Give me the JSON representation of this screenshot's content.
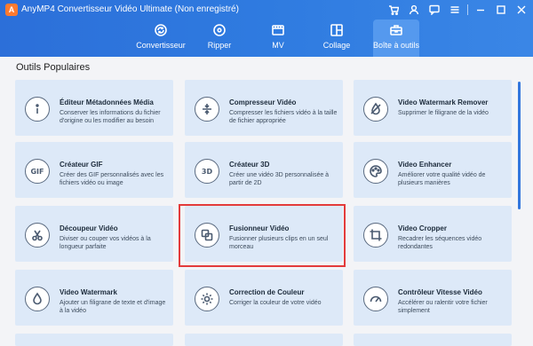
{
  "app": {
    "logo_letter": "A",
    "title": "AnyMP4 Convertisseur Vidéo Ultimate (Non enregistré)"
  },
  "window_controls": [
    "cart-icon",
    "user-icon",
    "chat-icon",
    "menu-icon",
    "minimize-icon",
    "maximize-icon",
    "close-icon"
  ],
  "tabs": [
    {
      "label": "Convertisseur",
      "icon": "convert-icon",
      "active": false
    },
    {
      "label": "Ripper",
      "icon": "disc-icon",
      "active": false
    },
    {
      "label": "MV",
      "icon": "mv-icon",
      "active": false
    },
    {
      "label": "Collage",
      "icon": "collage-icon",
      "active": false
    },
    {
      "label": "Boîte à outils",
      "icon": "toolbox-icon",
      "active": true
    }
  ],
  "section_title": "Outils Populaires",
  "cards": [
    {
      "title": "Éditeur Métadonnées Média",
      "desc": "Conserver les informations du fichier d'origine ou les modifier au besoin",
      "icon": "info-icon"
    },
    {
      "title": "Compresseur Vidéo",
      "desc": "Compresser les fichiers vidéo à la taille de fichier appropriée",
      "icon": "compress-icon"
    },
    {
      "title": "Video Watermark Remover",
      "desc": "Supprimer le filigrane de la vidéo",
      "icon": "watermark-remove-icon"
    },
    {
      "title": "Créateur GIF",
      "desc": "Créer des GIF personnalisés avec les fichiers vidéo ou image",
      "icon": "gif-icon",
      "icon_text": "GIF"
    },
    {
      "title": "Créateur 3D",
      "desc": "Créer une vidéo 3D personnalisée à partir de 2D",
      "icon": "3d-icon",
      "icon_text": "3D"
    },
    {
      "title": "Video Enhancer",
      "desc": "Améliorer votre qualité vidéo de plusieurs manières",
      "icon": "palette-icon"
    },
    {
      "title": "Découpeur Vidéo",
      "desc": "Diviser ou couper vos vidéos à la longueur parfaite",
      "icon": "scissors-icon"
    },
    {
      "title": "Fusionneur Vidéo",
      "desc": "Fusionner plusieurs clips en un seul morceau",
      "icon": "merge-icon"
    },
    {
      "title": "Video Cropper",
      "desc": "Recadrer les séquences vidéo redondantes",
      "icon": "crop-icon"
    },
    {
      "title": "Video Watermark",
      "desc": "Ajouter un filigrane de texte et d'image à la vidéo",
      "icon": "drop-icon"
    },
    {
      "title": "Correction de Couleur",
      "desc": "Corriger la couleur de votre vidéo",
      "icon": "sun-icon"
    },
    {
      "title": "Contrôleur Vitesse Vidéo",
      "desc": "Accélérer ou ralentir votre fichier simplement",
      "icon": "speed-icon"
    }
  ],
  "colors": {
    "header": "#2f7be0",
    "card": "#dde9f8",
    "highlight": "#e33b3b",
    "accent": "#3377dd"
  }
}
